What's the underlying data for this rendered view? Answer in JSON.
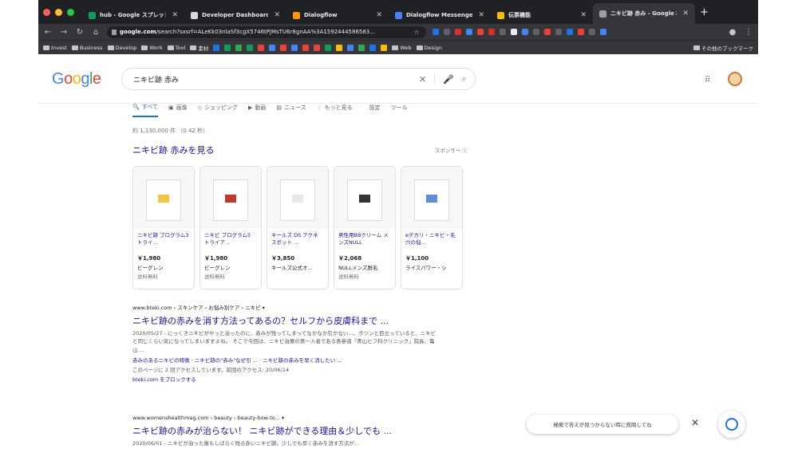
{
  "browser": {
    "traffic_colors": [
      "#ff5f57",
      "#febc2e",
      "#28c840"
    ],
    "tabs": [
      {
        "title": "hub - Google スプレッド",
        "color": "#0f9d58"
      },
      {
        "title": "Developer Dashboard",
        "color": "#d9d9d9"
      },
      {
        "title": "Dialogflow",
        "color": "#ff9800"
      },
      {
        "title": "Dialogflow Messenger |",
        "color": "#4285f4"
      },
      {
        "title": "伝票機能",
        "color": "#fbbc04"
      },
      {
        "title": "ニキビ跡 赤み - Google 検",
        "color": "#9aa0a6",
        "active": true
      }
    ],
    "new_tab_label": "+",
    "url_host": "google.com",
    "url_rest": "/search?sxsrf=ALeKk03nlaSf3cgX5746tPjMsTU6r8gnAA%3A1592444586583...",
    "bookmarks": [
      {
        "label": "Invest",
        "folder": true
      },
      {
        "label": "Business",
        "folder": true
      },
      {
        "label": "Develop",
        "folder": true
      },
      {
        "label": "Work",
        "folder": true
      },
      {
        "label": "Tool",
        "folder": true
      },
      {
        "label": "素材",
        "folder": true
      },
      {
        "label": "Web",
        "folder": true
      },
      {
        "label": "Design",
        "folder": true
      }
    ],
    "bookmark_icon_colors": [
      "#1a73e8",
      "#0f9d58",
      "#34a853",
      "#0f9d58",
      "#ea4335",
      "#4285f4",
      "#ea4335",
      "#4285f4",
      "#ea4335",
      "#ea4335",
      "#0f9d58",
      "#fbbc04",
      "#4285f4",
      "#34a853",
      "#1a73e8",
      "#fbbc04"
    ],
    "other_bookmarks": "その他のブックマーク",
    "extension_colors": [
      "#1a73e8",
      "#5f6368",
      "#d93025",
      "#4285f4",
      "#ea4335",
      "#d93025",
      "#5f6368",
      "#e8eaed",
      "#4285f4",
      "#5f6368",
      "#ea4335",
      "#5f6368",
      "#1a73e8",
      "#ea4335",
      "#5f6368",
      "#4285f4"
    ]
  },
  "google": {
    "logo_letters": [
      {
        "ch": "G",
        "color": "#4285f4"
      },
      {
        "ch": "o",
        "color": "#ea4335"
      },
      {
        "ch": "o",
        "color": "#fbbc05"
      },
      {
        "ch": "g",
        "color": "#4285f4"
      },
      {
        "ch": "l",
        "color": "#34a853"
      },
      {
        "ch": "e",
        "color": "#ea4335"
      }
    ],
    "query": "ニキビ跡 赤み",
    "tabs": [
      {
        "label": "すべて",
        "icon": "search-icon",
        "glyph": "🔍",
        "active": true
      },
      {
        "label": "画像",
        "icon": "image-icon",
        "glyph": "▣"
      },
      {
        "label": "ショッピング",
        "icon": "tag-icon",
        "glyph": "◇"
      },
      {
        "label": "動画",
        "icon": "video-icon",
        "glyph": "▶"
      },
      {
        "label": "ニュース",
        "icon": "news-icon",
        "glyph": "▤"
      },
      {
        "label": "もっと見る",
        "icon": "more-icon",
        "glyph": "⋮"
      },
      {
        "label": "設定",
        "icon": "",
        "glyph": ""
      },
      {
        "label": "ツール",
        "icon": "",
        "glyph": ""
      }
    ],
    "stats": "約 1,130,000 件 （0.42 秒）",
    "shopping_title": "ニキビ跡 赤みを見る",
    "sponsor": "スポンサー ⓘ",
    "products": [
      {
        "title": "ニキビ跡 プログラム3トライ...",
        "price": "￥1,980",
        "store": "ビーグレン",
        "ship": "送料無料",
        "accent": "#f4c542"
      },
      {
        "title": "ニキビ プログラム5 トライア...",
        "price": "￥1,980",
        "store": "ビーグレン",
        "ship": "送料無料",
        "accent": "#c0392b"
      },
      {
        "title": "キールズ DS アクネ スポット ...",
        "price": "￥3,850",
        "store": "キールズ公式オ...",
        "ship": "",
        "accent": "#e8e8e8"
      },
      {
        "title": "男性用BBクリーム メンズNULL",
        "price": "￥2,068",
        "store": "NULLメンズ脱毛",
        "ship": "送料無料",
        "accent": "#333333"
      },
      {
        "title": "eデカリ・ニキビ・毛穴の悩...",
        "price": "￥1,100",
        "store": "ライスパワー・シ",
        "ship": "",
        "accent": "#5b8fd6"
      }
    ],
    "results": [
      {
        "cite": "www.bteki.com › スキンケア › お悩み別ケア › ニキビ ▾",
        "title": "ニキビ跡の赤みを消す方法ってあるの？セルフから皮膚科まで ...",
        "snippet": "2020/05/27 - にっくきニキビがやっと治ったのに、赤みが残ってしまってなかなか引かない...、ポツンと目立っていると、ニキビと同じくらい気になってしまいますよね。 そこで今回は、ニキビ治療の第一人者である表参道「青山ヒフ科クリニック」院長、亀山 ...",
        "sublinks": "赤みのあるニキビの特徴 · ニキビ跡の\"赤み\"なぜ引 ... · ニキビ跡の赤みを早く消したい ...",
        "visited": "このページに 2 回アクセスしています。前回のアクセス: 20/06/14",
        "block": "bteki.com をブロックする"
      },
      {
        "cite": "www.womenshealthmag.com › beauty › beauty-how-to... ▾",
        "title": "ニキビ跡の赤みが治らない！ ニキビ跡ができる理由＆少しでも ...",
        "snippet": "2020/06/01 - ニキビが治った後もしばらく残る赤いニキビ跡。少しでも早く赤みを消す方法が..."
      }
    ],
    "help_pill": "検索で答えが見つからない時に質問してね",
    "help_close": "✕"
  }
}
